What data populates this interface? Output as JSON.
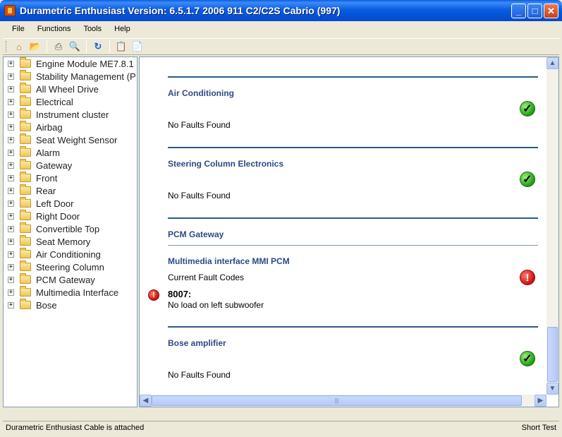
{
  "window": {
    "title": "Durametric Enthusiast Version: 6.5.1.7 2006 911 C2/C2S Cabrio (997)",
    "minimize": "_",
    "maximize": "□",
    "close": "✕"
  },
  "menu": {
    "items": [
      "File",
      "Functions",
      "Tools",
      "Help"
    ]
  },
  "toolbar": {
    "buttons": [
      {
        "name": "home-icon",
        "glyph": "⌂"
      },
      {
        "name": "open-folder-icon",
        "glyph": "📂"
      },
      {
        "name": "print-icon",
        "glyph": "⎙"
      },
      {
        "name": "print-preview-icon",
        "glyph": "🔍"
      },
      {
        "name": "refresh-icon",
        "glyph": "↻"
      },
      {
        "name": "report-icon",
        "glyph": "📋"
      },
      {
        "name": "clear-codes-icon",
        "glyph": "📄"
      }
    ]
  },
  "tree": {
    "items": [
      "Engine Module ME7.8.1",
      "Stability Management (P",
      "All Wheel Drive",
      "Electrical",
      "Instrument cluster",
      "Airbag",
      "Seat Weight Sensor",
      "Alarm",
      "Gateway",
      "Front",
      "Rear",
      "Left Door",
      "Right Door",
      "Convertible Top",
      "Seat Memory",
      "Air Conditioning",
      "Steering Column",
      "PCM Gateway",
      "Multimedia Interface",
      "Bose"
    ]
  },
  "content": {
    "sections": [
      {
        "title": "Air Conditioning",
        "status": "No Faults Found",
        "icon": "ok"
      },
      {
        "title": "Steering Column Electronics",
        "status": "No Faults Found",
        "icon": "ok"
      },
      {
        "title": "PCM Gateway"
      },
      {
        "title": "Multimedia interface MMI PCM",
        "status": "Current Fault Codes",
        "icon": "error",
        "fault": {
          "code": "8007:",
          "description": "No load on left subwoofer"
        }
      },
      {
        "title": "Bose amplifier",
        "status": "No Faults Found",
        "icon": "ok"
      }
    ]
  },
  "statusbar": {
    "left": "Durametric Enthusiast Cable is attached",
    "right": "Short Test"
  },
  "colors": {
    "titlebar": "#0a5ee0",
    "section_title": "#2c4a86",
    "ok": "#1f9a14",
    "error": "#cc1010"
  }
}
